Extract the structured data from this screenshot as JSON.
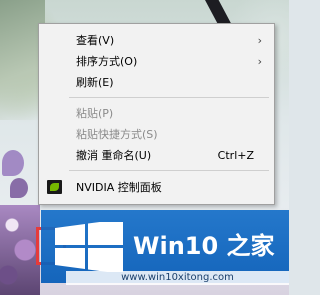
{
  "context_menu": {
    "items": [
      {
        "label": "查看(V)",
        "submenu": true,
        "disabled": false
      },
      {
        "label": "排序方式(O)",
        "submenu": true,
        "disabled": false
      },
      {
        "label": "刷新(E)",
        "disabled": false
      },
      {
        "label": "粘贴(P)",
        "disabled": true
      },
      {
        "label": "粘贴快捷方式(S)",
        "disabled": true
      },
      {
        "label": "撤消 重命名(U)",
        "shortcut": "Ctrl+Z",
        "disabled": false
      },
      {
        "label": "NVIDIA 控制面板",
        "disabled": false
      }
    ],
    "submenu_glyph": "›"
  },
  "watermark": {
    "brand": "Win10 之家",
    "url": "www.win10xitong.com",
    "colors": {
      "band": "#0f63be",
      "logo": "#ffffff"
    }
  },
  "highlight_color": "#e53b3b"
}
